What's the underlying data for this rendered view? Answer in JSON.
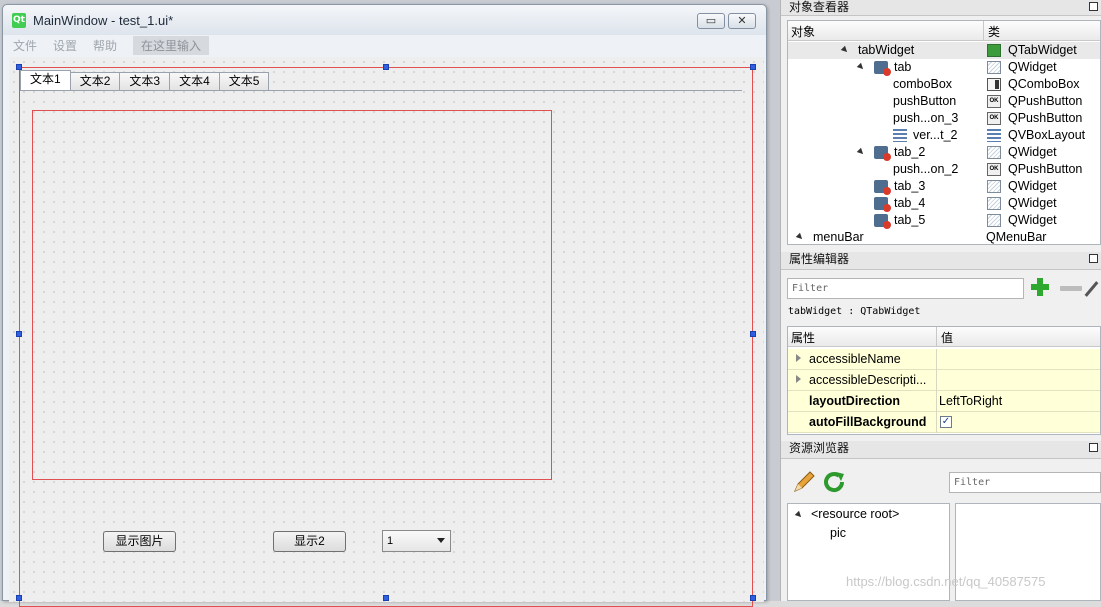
{
  "window": {
    "title": "MainWindow - test_1.ui*",
    "app_icon": "Qt",
    "minimize_symbol": "▭",
    "close_symbol": "✕"
  },
  "menubar": {
    "items": [
      "文件",
      "设置",
      "帮助"
    ],
    "placeholder": "在这里输入"
  },
  "form": {
    "tabs": [
      "文本1",
      "文本2",
      "文本3",
      "文本4",
      "文本5"
    ],
    "active_tab": 0,
    "buttons": {
      "show_pic": "显示图片",
      "show2": "显示2"
    },
    "combo_value": "1"
  },
  "object_inspector": {
    "title": "对象查看器",
    "headers": [
      "对象",
      "类"
    ],
    "rows": [
      {
        "name": "tabWidget",
        "cls": "QTabWidget",
        "icon": "tabwidget-icon"
      },
      {
        "name": "tab",
        "cls": "QWidget",
        "icon": "tab-object-icon"
      },
      {
        "name": "comboBox",
        "cls": "QComboBox",
        "icon": "combobox-icon"
      },
      {
        "name": "pushButton",
        "cls": "QPushButton",
        "icon": "pushbutton-icon"
      },
      {
        "name": "push...on_3",
        "cls": "QPushButton",
        "icon": "pushbutton-icon"
      },
      {
        "name": "ver...t_2",
        "cls": "QVBoxLayout",
        "icon": "vboxlayout-icon"
      },
      {
        "name": "tab_2",
        "cls": "QWidget",
        "icon": "tab-object-icon"
      },
      {
        "name": "push...on_2",
        "cls": "QPushButton",
        "icon": "pushbutton-icon"
      },
      {
        "name": "tab_3",
        "cls": "QWidget",
        "icon": "tab-object-icon"
      },
      {
        "name": "tab_4",
        "cls": "QWidget",
        "icon": "tab-object-icon"
      },
      {
        "name": "tab_5",
        "cls": "QWidget",
        "icon": "tab-object-icon"
      },
      {
        "name": "menuBar",
        "cls": "QMenuBar",
        "icon": ""
      }
    ]
  },
  "property_editor": {
    "title": "属性编辑器",
    "filter_placeholder": "Filter",
    "object_label": "tabWidget : QTabWidget",
    "headers": [
      "属性",
      "值"
    ],
    "rows": [
      {
        "name": "accessibleName",
        "value": ""
      },
      {
        "name": "accessibleDescripti...",
        "value": ""
      },
      {
        "name": "layoutDirection",
        "value": "LeftToRight"
      },
      {
        "name": "autoFillBackground",
        "value": "✓"
      }
    ]
  },
  "resource_browser": {
    "title": "资源浏览器",
    "filter_placeholder": "Filter",
    "root": "<resource root>",
    "child": "pic"
  },
  "watermark": "https://blog.csdn.net/qq_40587575"
}
